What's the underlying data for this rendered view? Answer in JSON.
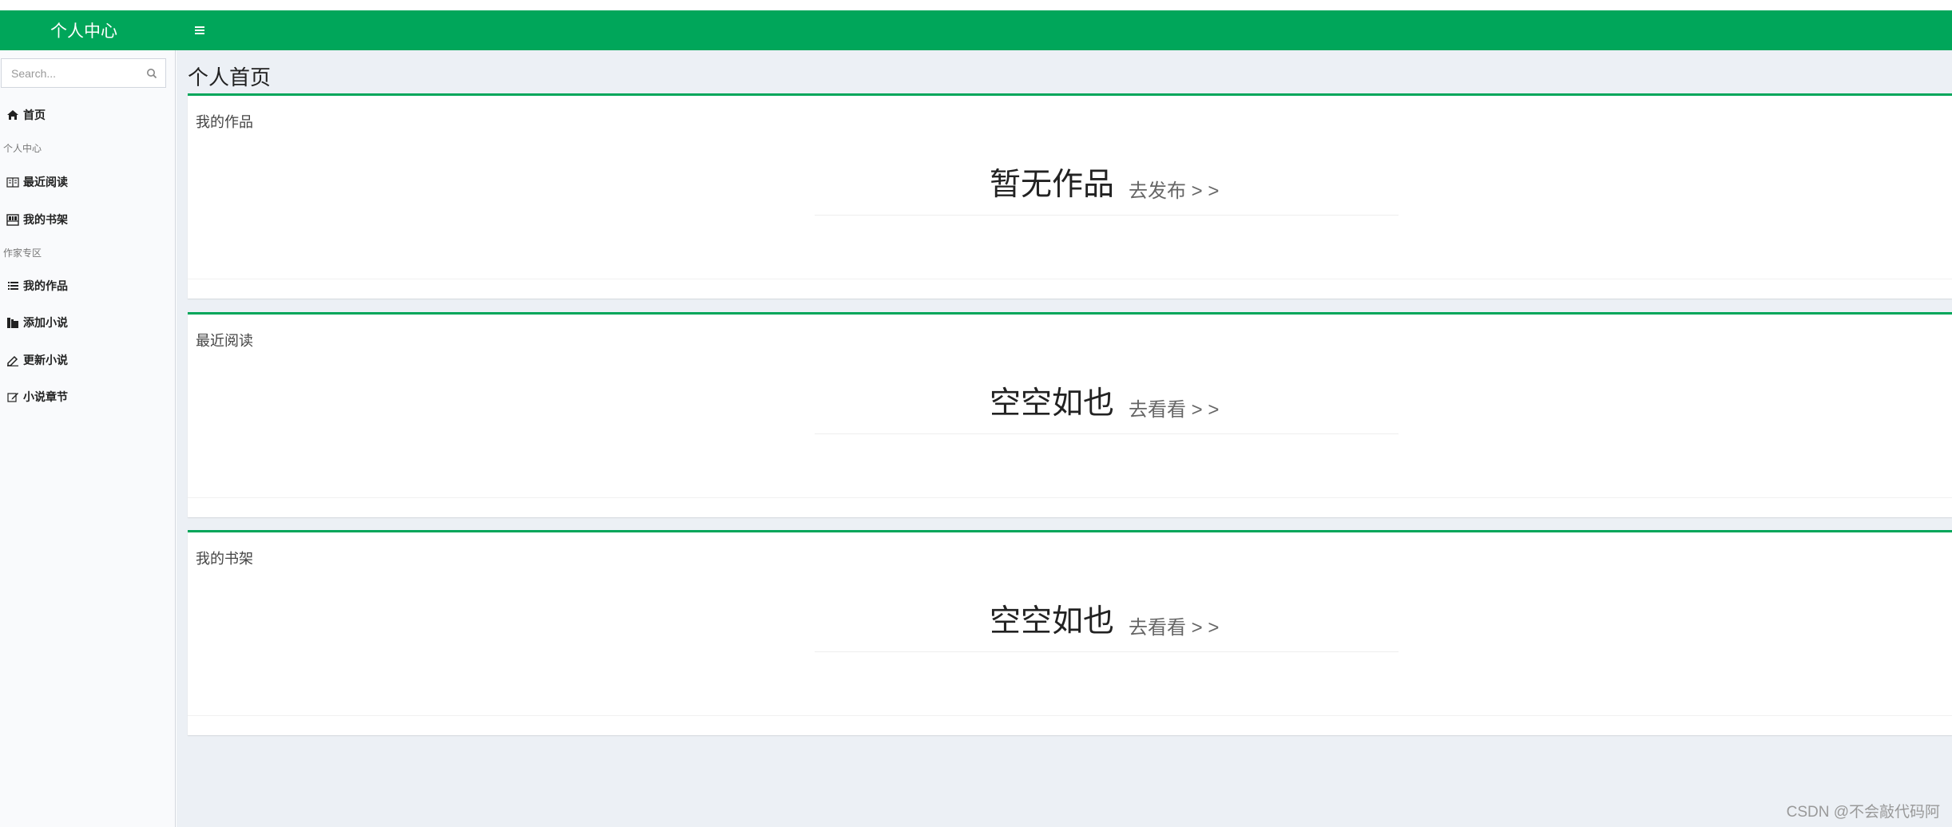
{
  "header": {
    "brand": "个人中心",
    "menu_icon": "hamburger-icon",
    "accent_color": "#00a65a"
  },
  "sidebar": {
    "search_placeholder": "Search...",
    "search_icon": "search-icon",
    "items": [
      {
        "label": "首页",
        "icon": "home-icon"
      },
      {
        "header": "个人中心"
      },
      {
        "label": "最近阅读",
        "icon": "book-open-icon"
      },
      {
        "label": "我的书架",
        "icon": "bookshelf-icon"
      },
      {
        "header": "作家专区"
      },
      {
        "label": "我的作品",
        "icon": "list-icon"
      },
      {
        "label": "添加小说",
        "icon": "book-plus-icon"
      },
      {
        "label": "更新小说",
        "icon": "pencil-icon"
      },
      {
        "label": "小说章节",
        "icon": "edit-icon"
      }
    ]
  },
  "main": {
    "title": "个人首页",
    "boxes": [
      {
        "title": "我的作品",
        "empty_text": "暂无作品",
        "link_text": "去发布 > >"
      },
      {
        "title": "最近阅读",
        "empty_text": "空空如也",
        "link_text": "去看看 > >"
      },
      {
        "title": "我的书架",
        "empty_text": "空空如也",
        "link_text": "去看看 > >"
      }
    ]
  },
  "watermark": "CSDN @不会敲代码阿"
}
